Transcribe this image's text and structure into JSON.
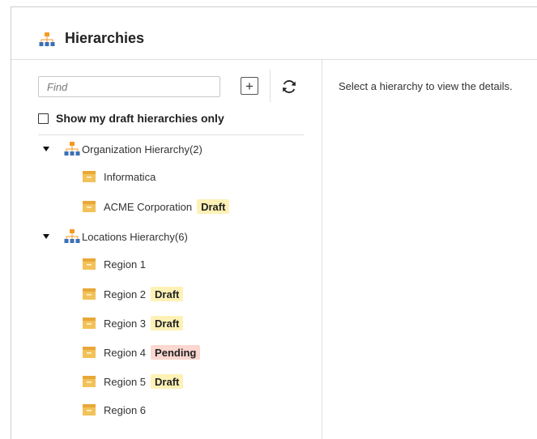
{
  "header": {
    "title": "Hierarchies",
    "icon": "org-hierarchy-icon"
  },
  "search": {
    "placeholder": "Find",
    "value": ""
  },
  "toolbar": {
    "add_label": "+",
    "add_icon": "plus-icon",
    "refresh_icon": "refresh-icon"
  },
  "filter": {
    "label": "Show my draft hierarchies only",
    "checked": false
  },
  "tree": [
    {
      "label": "Organization Hierarchy(2)",
      "expanded": true,
      "children": [
        {
          "label": "Informatica",
          "badge": ""
        },
        {
          "label": "ACME Corporation",
          "badge": "Draft"
        }
      ]
    },
    {
      "label": "Locations Hierarchy(6)",
      "expanded": true,
      "children": [
        {
          "label": "Region 1",
          "badge": ""
        },
        {
          "label": "Region 2",
          "badge": "Draft"
        },
        {
          "label": "Region 3",
          "badge": "Draft"
        },
        {
          "label": "Region 4",
          "badge": "Pending"
        },
        {
          "label": "Region 5",
          "badge": "Draft"
        },
        {
          "label": "Region 6",
          "badge": ""
        }
      ]
    }
  ],
  "detail": {
    "message": "Select a hierarchy to view the details."
  },
  "colors": {
    "draft_badge": "#fdf1b6",
    "pending_badge": "#fbd7d0",
    "hierarchy_icon": "#f59a23",
    "node_icon": "#f2c25a",
    "icon_blue": "#3d6fb6"
  }
}
